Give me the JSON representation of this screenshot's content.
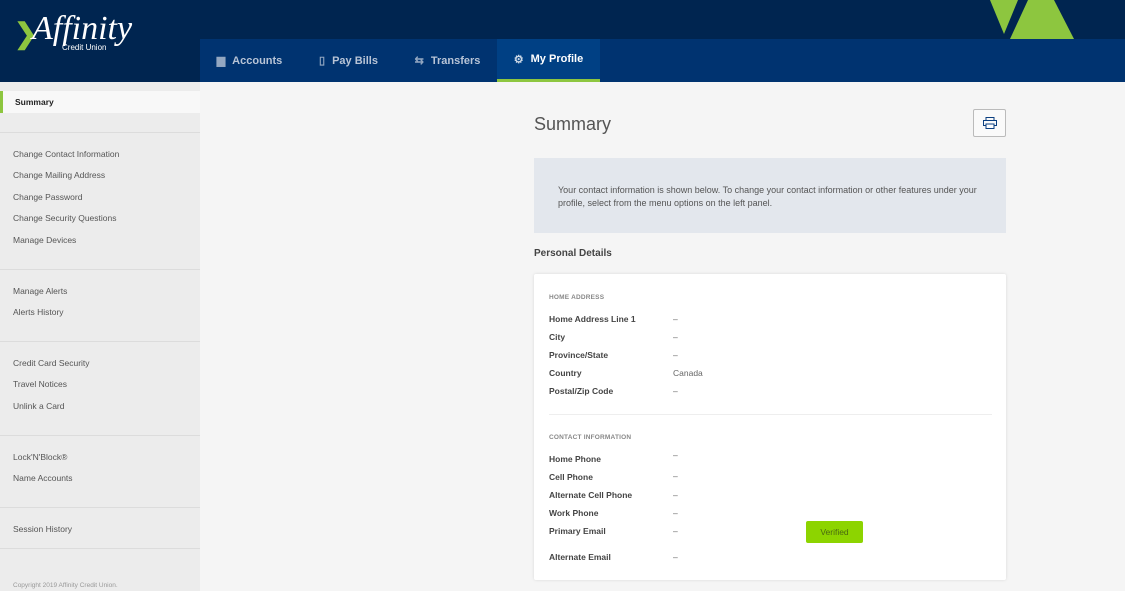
{
  "brand": {
    "logo_text": "Affinity",
    "logo_sub": "Credit Union",
    "accent": "#8dc63f",
    "navy": "#002550"
  },
  "nav": {
    "tabs": [
      {
        "label": "Accounts",
        "icon": "wallet-icon"
      },
      {
        "label": "Pay Bills",
        "icon": "bill-icon"
      },
      {
        "label": "Transfers",
        "icon": "transfer-arrows-icon"
      },
      {
        "label": "My Profile",
        "icon": "gear-icon",
        "active": true
      }
    ]
  },
  "sidebar": {
    "summary": "Summary",
    "items": [
      "Change Contact Information",
      "Change Mailing Address",
      "Change Password",
      "Change Security Questions",
      "Manage Devices",
      "Manage Alerts",
      "Alerts History",
      "Credit Card Security",
      "Travel Notices",
      "Unlink a Card",
      "Lock'N'Block®",
      "Name Accounts",
      "Session History"
    ],
    "copyright": "Copyright 2019 Affinity Credit Union."
  },
  "main": {
    "title": "Summary",
    "info": "Your contact information is shown below. To change your contact information or other features under your profile, select from the menu options on the left panel.",
    "section_title": "Personal Details",
    "home_heading": "HOME ADDRESS",
    "home": [
      {
        "label": "Home Address Line 1",
        "value": "–"
      },
      {
        "label": "City",
        "value": "–"
      },
      {
        "label": "Province/State",
        "value": "–"
      },
      {
        "label": "Country",
        "value": "Canada"
      },
      {
        "label": "Postal/Zip Code",
        "value": "–"
      }
    ],
    "contact_heading": "CONTACT INFORMATION",
    "contact": [
      {
        "label": "Home Phone",
        "value": "–"
      },
      {
        "label": "Cell Phone",
        "value": "–"
      },
      {
        "label": "Alternate Cell Phone",
        "value": "–"
      },
      {
        "label": "Work Phone",
        "value": "–"
      },
      {
        "label": "Primary Email",
        "value": "–"
      },
      {
        "label": "Alternate Email",
        "value": "–"
      }
    ],
    "verified": "Verified"
  }
}
